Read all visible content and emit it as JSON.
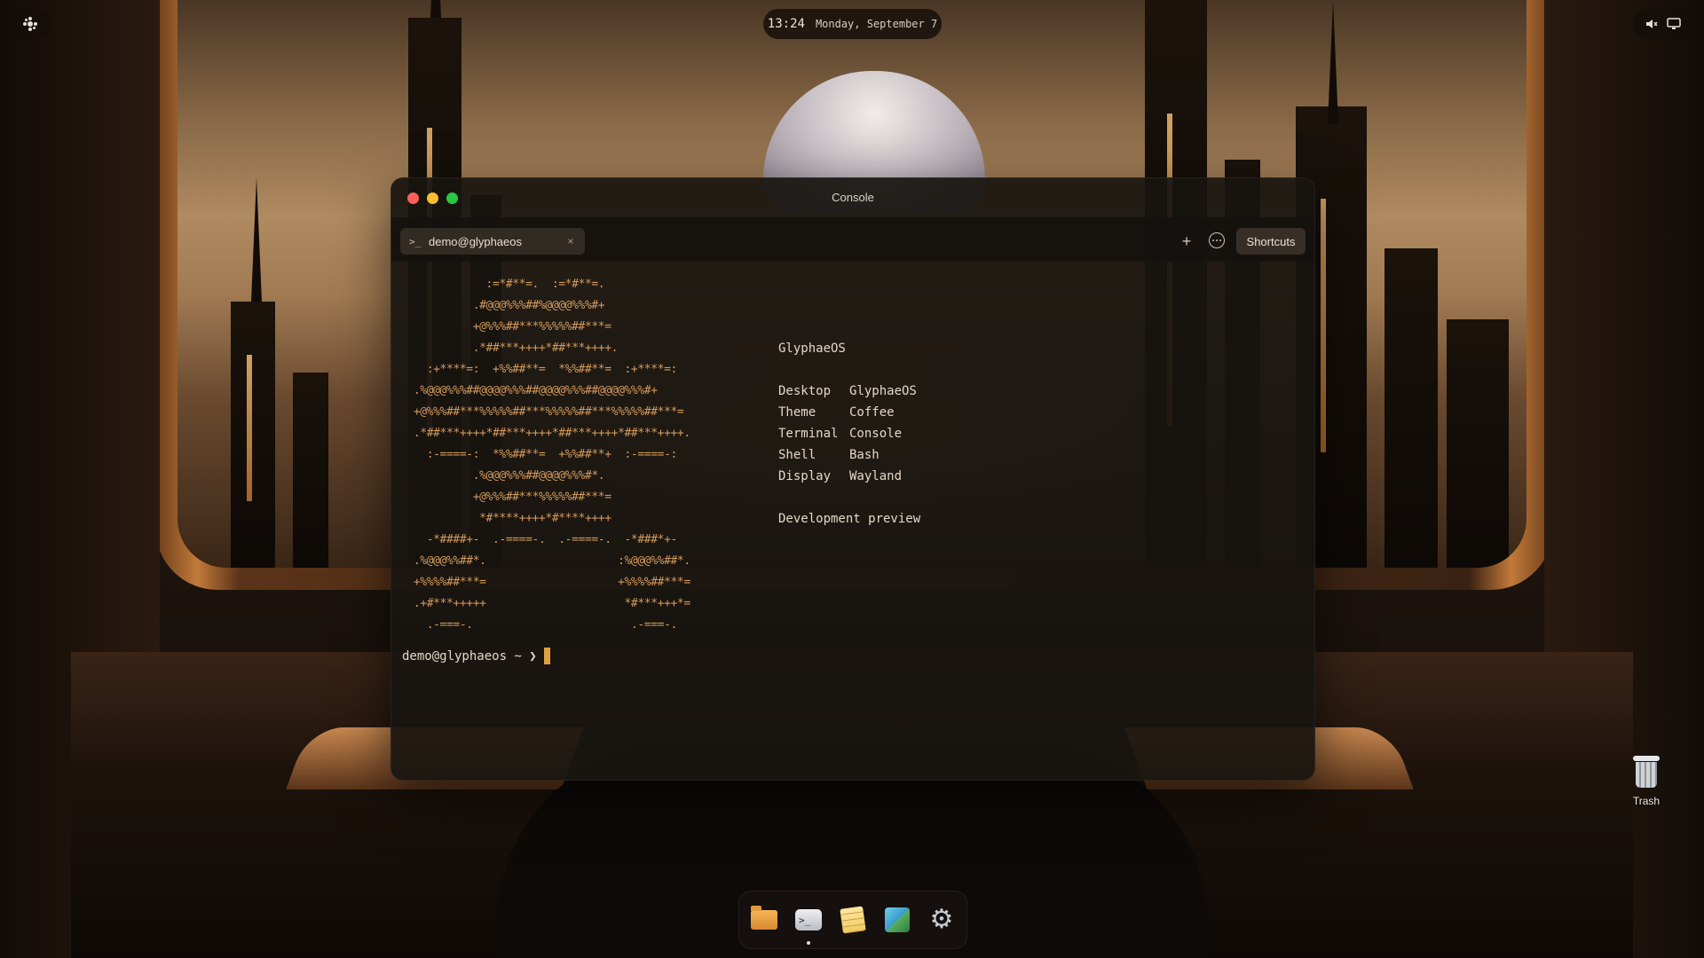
{
  "topbar": {
    "time": "13:24",
    "date": "Monday, September 7",
    "left_icon": "activities-icon",
    "right_icons": [
      "volume-muted-icon",
      "display-icon"
    ]
  },
  "window": {
    "title": "Console",
    "tab": {
      "icon": ">_",
      "label": "demo@glyphaeos",
      "close": "×"
    },
    "new_tab_label": "+",
    "shortcuts_label": "Shortcuts"
  },
  "terminal": {
    "ascii_art": "             :=*#**=.  :=*#**=.\n           .#@@@%%%##%@@@@%%%#+\n           +@%%%##***%%%%%##***=\n           .*##***++++*##***++++.\n    :+****=:  +%%##**=  *%%##**=  :+****=:\n  .%@@@%%%##@@@@%%%##@@@@%%%##@@@@%%%#+\n  +@%%%##***%%%%%##***%%%%%##***%%%%%##***=\n  .*##***++++*##***++++*##***++++*##***++++.\n    :-====-:  *%%##**=  +%%##**+  :-====-:\n           .%@@@%%%##@@@@%%%#*.\n           +@%%%##***%%%%%##***=\n            *#****++++*#****++++\n    -*####+-  .-====-.  .-====-.  -*###*+-\n  .%@@@%%##*.                    :%@@@%%##*.\n  +%%%%##***=                    +%%%%##***=\n  .+#***+++++                     *#***+++*=\n    .-===-.                        .-===-.",
    "info_title": "GlyphaeOS",
    "info": [
      {
        "key": "Desktop",
        "value": "GlyphaeOS"
      },
      {
        "key": "Theme",
        "value": "Coffee"
      },
      {
        "key": "Terminal",
        "value": "Console"
      },
      {
        "key": "Shell",
        "value": "Bash"
      },
      {
        "key": "Display",
        "value": "Wayland"
      }
    ],
    "footer": "Development preview",
    "prompt": "demo@glyphaeos ~ ❯"
  },
  "desktop": {
    "trash_label": "Trash"
  },
  "dock": {
    "items": [
      "file-manager-icon",
      "terminal-icon",
      "notes-icon",
      "photos-icon",
      "settings-icon"
    ],
    "terminal_icon_glyph": ">_",
    "settings_icon_glyph": "⚙"
  }
}
